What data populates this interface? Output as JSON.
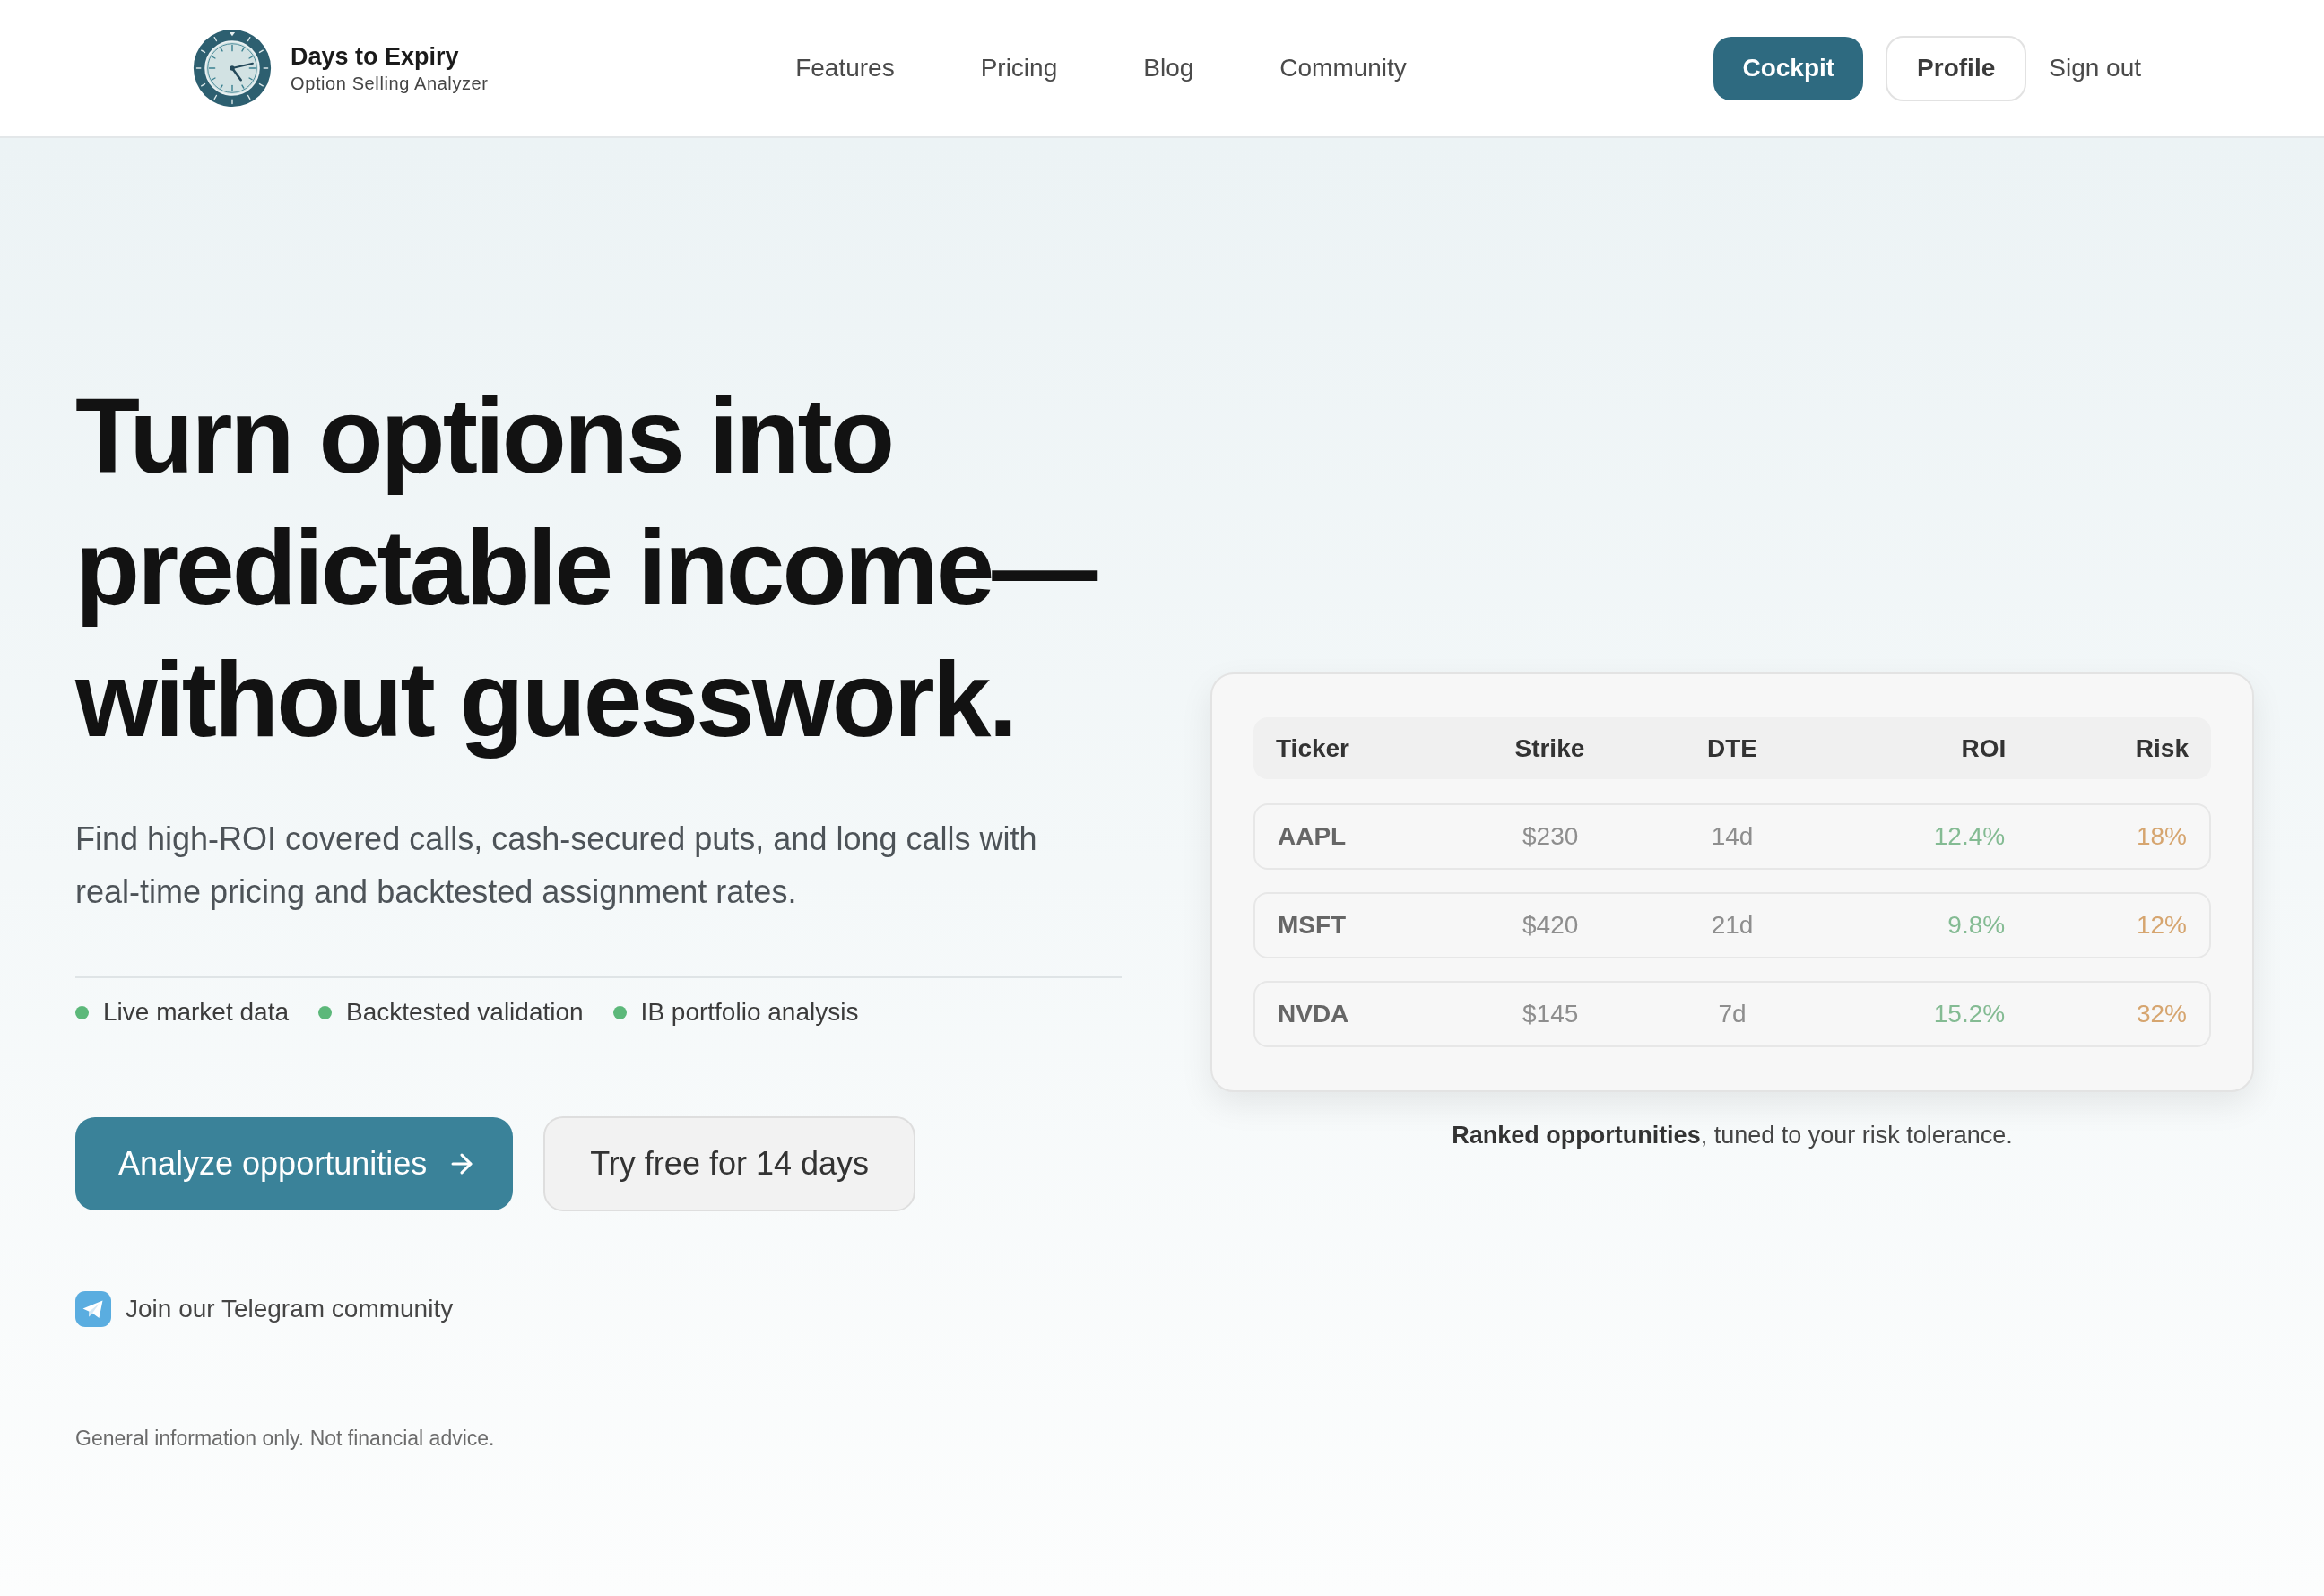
{
  "header": {
    "logo": {
      "title": "Days to Expiry",
      "subtitle": "Option Selling Analyzer"
    },
    "nav": [
      "Features",
      "Pricing",
      "Blog",
      "Community"
    ],
    "actions": [
      {
        "label": "Cockpit",
        "kind": "primary"
      },
      {
        "label": "Profile",
        "kind": "outline"
      },
      {
        "label": "Sign out",
        "kind": "link"
      }
    ]
  },
  "hero": {
    "headline_lines": [
      "Turn options into",
      "predictable income—",
      "without guesswork."
    ],
    "description": "Find high-ROI covered calls, cash-secured puts, and long calls with real-time pricing and backtested assignment rates.",
    "features": [
      "Live market data",
      "Backtested validation",
      "IB portfolio analysis"
    ],
    "buttons": [
      {
        "label": "Analyze opportunities",
        "kind": "primary"
      },
      {
        "label": "Try free for 14 days",
        "kind": "secondary"
      }
    ],
    "community_link": "Join our Telegram community",
    "disclaimer": "General information only. Not financial advice."
  },
  "preview": {
    "table": {
      "columns": [
        "Ticker",
        "Strike",
        "DTE",
        "ROI",
        "Risk"
      ],
      "rows": [
        {
          "ticker": "AAPL",
          "strike": "$230",
          "dte": "14d",
          "roi": "12.4%",
          "risk": "18%"
        },
        {
          "ticker": "MSFT",
          "strike": "$420",
          "dte": "21d",
          "roi": "9.8%",
          "risk": "12%"
        },
        {
          "ticker": "NVDA",
          "strike": "$145",
          "dte": "7d",
          "roi": "15.2%",
          "risk": "32%"
        }
      ]
    },
    "caption": "**Ranked opportunities**, tuned to your risk tolerance."
  }
}
